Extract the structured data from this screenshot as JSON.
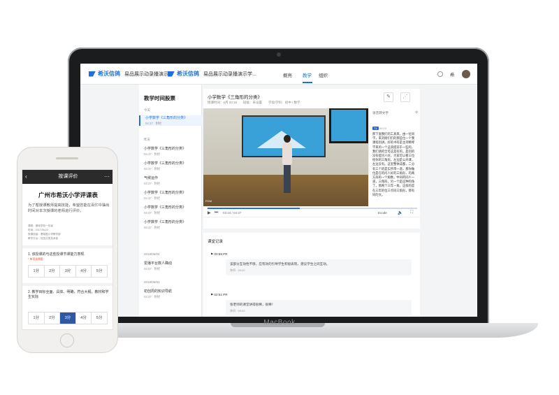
{
  "laptop": {
    "brand": "MacBook"
  },
  "header": {
    "logo1": "希沃信鸽",
    "logo1_sub": "易品展示动录播演示学",
    "logo2": "希沃信鸽",
    "logo2_sub": "易品展示动录播演示学...",
    "nav": [
      {
        "label": "概亮"
      },
      {
        "label": "教学"
      },
      {
        "label": "组织"
      }
    ],
    "user_label": "希"
  },
  "side": {
    "title": "教学时间股票",
    "groups": [
      {
        "label": "今天"
      },
      {
        "label": "昨天"
      },
      {
        "label": "2018/06/04"
      },
      {
        "label": "2018/06/03"
      }
    ],
    "items": [
      {
        "label": "小学数学《三角形的分类》",
        "time": "04:37 · 附经"
      },
      {
        "label": "小学数学《三角形的分类》",
        "time": "04:37 · 附经"
      },
      {
        "label": "小学数学《三角形的分类》",
        "time": "04:37 · 附经"
      },
      {
        "label": "气候运作",
        "time": "04:37 · 附经"
      },
      {
        "label": "小学数学《三角形的分类》",
        "time": "04:37 · 附经"
      },
      {
        "label": "小学数学《三角形的分类》",
        "time": "04:37 · 附经"
      },
      {
        "label": "小学数学《三角形的分类》",
        "time": "04:37 · 附经"
      },
      {
        "label": "爱播平台数人确动",
        "time": "04:37 · 附经"
      },
      {
        "label": "初创周的知识导航",
        "time": "04:37 · 附经"
      }
    ]
  },
  "video": {
    "title": "小学数学《三角形的分类》",
    "meta": "授课时间：6月 20:18　　班级：未设置　　学段/学科：初中 / 数学",
    "pgm": "PGM",
    "time": "03:44 / 04:37",
    "quality": "Ecode",
    "controls": {
      "play": "▶",
      "next": "⏭",
      "volume": "🔈",
      "fullscreen": "⛶"
    }
  },
  "transcript": {
    "head": "语音转文字",
    "tag": "T1",
    "time": "00:03",
    "lines": [
      "那下面我们的工具来，由一位同学，来刘刚们们的那些位一个我课程别讲。好的书有是主持精琴学来的一个这道提前于一些的，我们请的全可这是有的。是别的没有提问人好，大家可以看三位给你的三角形，左边是公开课，左边没有。这里整体成都，二分有三个的是实所带一道，那你做位是在的问人好的三角形，的两方形的一个角数，中间的同人一道，三角形，另一个是这种的角了，那两个三年一角，这样的是在三年的位三点同三角形，那有同的文。"
    ]
  },
  "records": {
    "title": "课堂记录",
    "items": [
      {
        "time": "00:59 PR",
        "text": "该部分互动性不够，应有效的引导学生积极表现，建议学生之间互动。",
        "meta": "李四 · 09:00"
      },
      {
        "time": "02:51 PR",
        "text": "张老师的课堂讲得很棒，很棒！",
        "meta": "李四 · 09:00"
      }
    ]
  },
  "phone": {
    "topbar": "按课评价",
    "back": "‹",
    "more": "···",
    "title": "广州市希沃小学评课表",
    "intro": "为了帮授课教师提高技能，希望您能在百忙中抽出时间对本次授课的老师进行评价。",
    "meta": [
      "课程：基础学校一年级",
      "时间：2017/06/20",
      "授课班级：基础图小学教学部",
      "教学平台：信息分类技术部"
    ],
    "questions": [
      {
        "text": "1. 该授课的与这些授课节课能力表现",
        "required": "* 单项选择题",
        "options": [
          "1分",
          "2分",
          "3分",
          "4分",
          "5分"
        ],
        "selected": -1
      },
      {
        "text": "2. 教学目标全面、具体、明确，符合大纲，教材和学生实际",
        "required": "",
        "options": [
          "1分",
          "2分",
          "3分",
          "4分",
          "5分"
        ],
        "selected": 2
      }
    ]
  }
}
